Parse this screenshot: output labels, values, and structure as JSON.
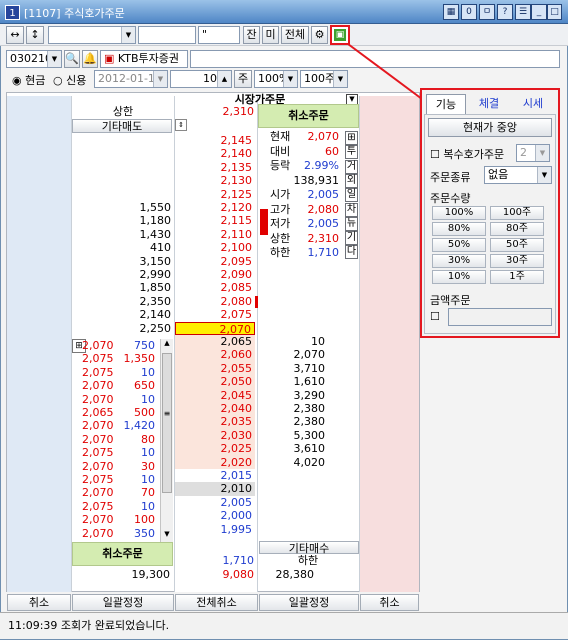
{
  "window": {
    "number": "1",
    "title": "[1107] 주식호가주문",
    "title_buttons": [
      "▦",
      "0",
      "ㅁ",
      "?",
      "☰",
      "_",
      "□",
      "×"
    ]
  },
  "toolbar": {
    "arrow1": "↔",
    "arrow2": "↕",
    "field1": "",
    "field2": "",
    "field3": "",
    "field4": "\"",
    "btn_jan": "잔",
    "btn_mi": "미",
    "btn_all": "전체",
    "gear": "⚙",
    "logo": "▣"
  },
  "row2": {
    "code": "030210",
    "broker": "KTB투자증권",
    "name": ""
  },
  "row3": {
    "cash": "현금",
    "credit": "신용",
    "date": "2012-01-10",
    "qty": "10",
    "unit": "주",
    "pct": "100%",
    "lot": "100주"
  },
  "table": {
    "market_order_label": "시장가주문",
    "upper_label": "상한",
    "upper_price": "2,310",
    "other_sell": "기타매도",
    "cancel_top": "취소주문",
    "cancel_bottom": "취소주문",
    "other_buy": "기타매수",
    "lower_label": "하한",
    "lower_price": "1,710",
    "total_sell": "19,300",
    "total_buy": "28,380",
    "total_price": "9,080",
    "sell_rows": [
      {
        "price": "2,145",
        "qty": ""
      },
      {
        "price": "2,140",
        "qty": ""
      },
      {
        "price": "2,135",
        "qty": ""
      },
      {
        "price": "2,130",
        "qty": ""
      },
      {
        "price": "2,125",
        "qty": ""
      },
      {
        "price": "2,120",
        "qty": "1,550"
      },
      {
        "price": "2,115",
        "qty": "1,180"
      },
      {
        "price": "2,110",
        "qty": "1,430"
      },
      {
        "price": "2,100",
        "qty": "410"
      },
      {
        "price": "2,095",
        "qty": "3,150"
      },
      {
        "price": "2,090",
        "qty": "2,990"
      },
      {
        "price": "2,085",
        "qty": "1,850"
      },
      {
        "price": "2,080",
        "qty": "2,350"
      },
      {
        "price": "2,075",
        "qty": "2,140"
      },
      {
        "price": "2,070",
        "qty": "2,250"
      }
    ],
    "buy_rows": [
      {
        "price": "2,065",
        "qty": "10"
      },
      {
        "price": "2,060",
        "qty": "2,070"
      },
      {
        "price": "2,055",
        "qty": "3,710"
      },
      {
        "price": "2,050",
        "qty": "1,610"
      },
      {
        "price": "2,045",
        "qty": "3,290"
      },
      {
        "price": "2,040",
        "qty": "2,380"
      },
      {
        "price": "2,035",
        "qty": "2,380"
      },
      {
        "price": "2,030",
        "qty": "5,300"
      },
      {
        "price": "2,025",
        "qty": "3,610"
      },
      {
        "price": "2,020",
        "qty": "4,020"
      },
      {
        "price": "2,015",
        "qty": ""
      },
      {
        "price": "2,010",
        "qty": ""
      },
      {
        "price": "2,005",
        "qty": ""
      },
      {
        "price": "2,000",
        "qty": ""
      },
      {
        "price": "1,995",
        "qty": ""
      }
    ],
    "trades": [
      {
        "p": "2,070",
        "q": "750"
      },
      {
        "p": "2,075",
        "q": "1,350"
      },
      {
        "p": "2,075",
        "q": "10"
      },
      {
        "p": "2,070",
        "q": "650"
      },
      {
        "p": "2,070",
        "q": "10"
      },
      {
        "p": "2,065",
        "q": "500"
      },
      {
        "p": "2,070",
        "q": "1,420"
      },
      {
        "p": "2,070",
        "q": "80"
      },
      {
        "p": "2,075",
        "q": "10"
      },
      {
        "p": "2,070",
        "q": "30"
      },
      {
        "p": "2,075",
        "q": "10"
      },
      {
        "p": "2,070",
        "q": "70"
      },
      {
        "p": "2,075",
        "q": "10"
      },
      {
        "p": "2,070",
        "q": "100"
      },
      {
        "p": "2,070",
        "q": "350"
      }
    ],
    "info": [
      {
        "k": "현재",
        "v": "2,070"
      },
      {
        "k": "대비",
        "v": "60"
      },
      {
        "k": "등락",
        "v": "2.99%"
      },
      {
        "k": "",
        "v": "138,931"
      },
      {
        "k": "시가",
        "v": "2,005"
      },
      {
        "k": "고가",
        "v": "2,080"
      },
      {
        "k": "저가",
        "v": "2,005"
      },
      {
        "k": "상한",
        "v": "2,310"
      },
      {
        "k": "하한",
        "v": "1,710"
      }
    ],
    "vbtns": [
      "⊞",
      "투",
      "거",
      "외",
      "일",
      "차",
      "뉴",
      "기",
      "다"
    ]
  },
  "bottom": {
    "b1": "취소",
    "b2": "일괄정정",
    "b3": "전체취소",
    "b4": "일괄정정",
    "b5": "취소"
  },
  "status": {
    "text": "11:09:39 조회가 완료되었습니다."
  },
  "popup": {
    "tabs": [
      "기능",
      "체결",
      "시세"
    ],
    "center_btn": "현재가 중앙",
    "multi": "복수호가주문",
    "multi_val": "2",
    "order_type_label": "주문종류",
    "order_type_val": "없음",
    "qty_label": "주문수량",
    "qty_btns": [
      "100%",
      "100주",
      "80%",
      "80주",
      "50%",
      "50주",
      "30%",
      "30주",
      "10%",
      "1주"
    ],
    "amount_label": "금액주문"
  }
}
